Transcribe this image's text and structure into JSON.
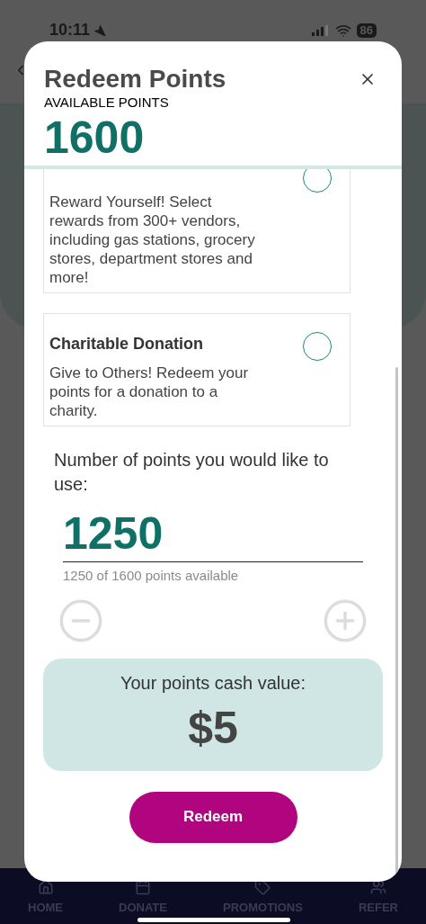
{
  "status_bar": {
    "time": "10:11",
    "battery": "86"
  },
  "modal": {
    "title": "Redeem Points",
    "available_label": "AVAILABLE POINTS",
    "available_points": "1600",
    "options": [
      {
        "description": "Reward Yourself! Select rewards from 300+ vendors, including gas stations, grocery stores, department stores and more!",
        "selected": false
      },
      {
        "title": "Charitable Donation",
        "description": "Give to Others! Redeem your points for a donation to a charity.",
        "selected": false
      }
    ],
    "points_prompt": "Number of points you would like to use:",
    "points_value": "1250",
    "points_hint": "1250 of 1600 points available",
    "cash_label": "Your points cash value:",
    "cash_value": "$5",
    "redeem_button": "Redeem"
  },
  "tab_bar": [
    {
      "label": "HOME",
      "kind": "home"
    },
    {
      "label": "DONATE",
      "kind": "calendar"
    },
    {
      "label": "PROMOTIONS",
      "kind": "tag"
    },
    {
      "label": "REFER",
      "kind": "users"
    }
  ]
}
